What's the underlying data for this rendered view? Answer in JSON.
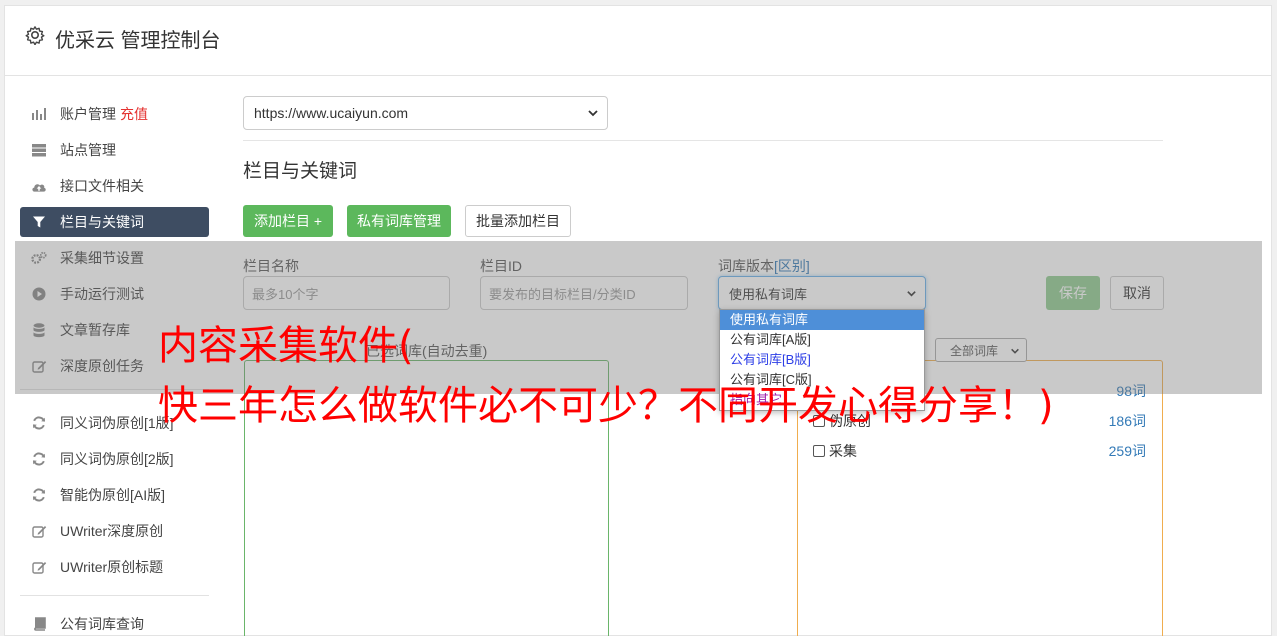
{
  "app": {
    "title": "优采云 管理控制台"
  },
  "sidebar": {
    "items": [
      {
        "label": "账户管理",
        "extra": "充值",
        "icon": "bar-chart-icon"
      },
      {
        "label": "站点管理",
        "icon": "server-icon"
      },
      {
        "label": "接口文件相关",
        "icon": "cloud-upload-icon"
      },
      {
        "label": "栏目与关键词",
        "icon": "filter-icon",
        "active": true
      },
      {
        "label": "采集细节设置",
        "icon": "gears-icon"
      },
      {
        "label": "手动运行测试",
        "icon": "play-circle-icon"
      },
      {
        "label": "文章暂存库",
        "icon": "database-icon"
      },
      {
        "label": "深度原创任务",
        "icon": "edit-icon"
      },
      {
        "label": "同义词伪原创[1版]",
        "icon": "refresh-icon"
      },
      {
        "label": "同义词伪原创[2版]",
        "icon": "refresh-icon"
      },
      {
        "label": "智能伪原创[AI版]",
        "icon": "refresh-icon"
      },
      {
        "label": "UWriter深度原创",
        "icon": "edit-icon"
      },
      {
        "label": "UWriter原创标题",
        "icon": "edit-icon"
      },
      {
        "label": "公有词库查询",
        "icon": "book-icon"
      }
    ]
  },
  "main": {
    "site_select_value": "https://www.ucaiyun.com",
    "section_title": "栏目与关键词",
    "buttons": {
      "add_column": "添加栏目 +",
      "private_lib": "私有词库管理",
      "batch_add": "批量添加栏目"
    },
    "form": {
      "name_label": "栏目名称",
      "name_placeholder": "最多10个字",
      "id_label": "栏目ID",
      "id_placeholder": "要发布的目标栏目/分类ID",
      "lib_label": "词库版本",
      "lib_label_link": "[区别]",
      "lib_value": "使用私有词库",
      "save": "保存",
      "cancel": "取消"
    },
    "lib_dropdown": {
      "options": [
        "使用私有词库",
        "公有词库[A版]",
        "公有词库[B版]",
        "公有词库[C版]",
        "指向其它"
      ]
    },
    "selected_label": "已选词库(自动去重)",
    "all_lib_select": "全部词库",
    "libraries": [
      {
        "name": "",
        "count": "98词"
      },
      {
        "name": "伪原创",
        "count": "186词"
      },
      {
        "name": "采集",
        "count": "259词"
      }
    ]
  },
  "watermark": {
    "line1": "内容采集软件(",
    "line2": "快三年怎么做软件必不可少？不同开发心得分享！)"
  }
}
